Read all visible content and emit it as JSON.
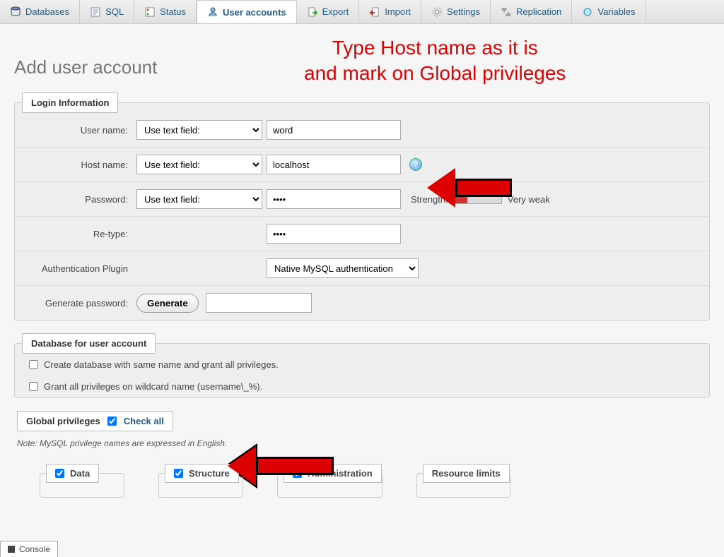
{
  "tabs": {
    "databases": "Databases",
    "sql": "SQL",
    "status": "Status",
    "user_accounts": "User accounts",
    "export": "Export",
    "import": "Import",
    "settings": "Settings",
    "replication": "Replication",
    "variables": "Variables"
  },
  "page_title": "Add user account",
  "annotation_line1": "Type Host name as it is",
  "annotation_line2": "and mark on Global privileges",
  "login_info": {
    "legend": "Login Information",
    "username_label": "User name:",
    "username_select": "Use text field:",
    "username_value": "word",
    "hostname_label": "Host name:",
    "hostname_select": "Use text field:",
    "hostname_value": "localhost",
    "password_label": "Password:",
    "password_select": "Use text field:",
    "password_value": "••••",
    "strength_label": "Strength:",
    "strength_text": "Very weak",
    "retype_label": "Re-type:",
    "retype_value": "••••",
    "auth_label": "Authentication Plugin",
    "auth_select": "Native MySQL authentication",
    "gen_label": "Generate password:",
    "gen_button": "Generate"
  },
  "db_for_user": {
    "legend": "Database for user account",
    "opt1": "Create database with same name and grant all privileges.",
    "opt2": "Grant all privileges on wildcard name (username\\_%)."
  },
  "global_priv": {
    "legend": "Global privileges",
    "check_all": "Check all",
    "note": "Note: MySQL privilege names are expressed in English.",
    "data": "Data",
    "structure": "Structure",
    "administration": "Administration",
    "resource": "Resource limits"
  },
  "console": "Console"
}
